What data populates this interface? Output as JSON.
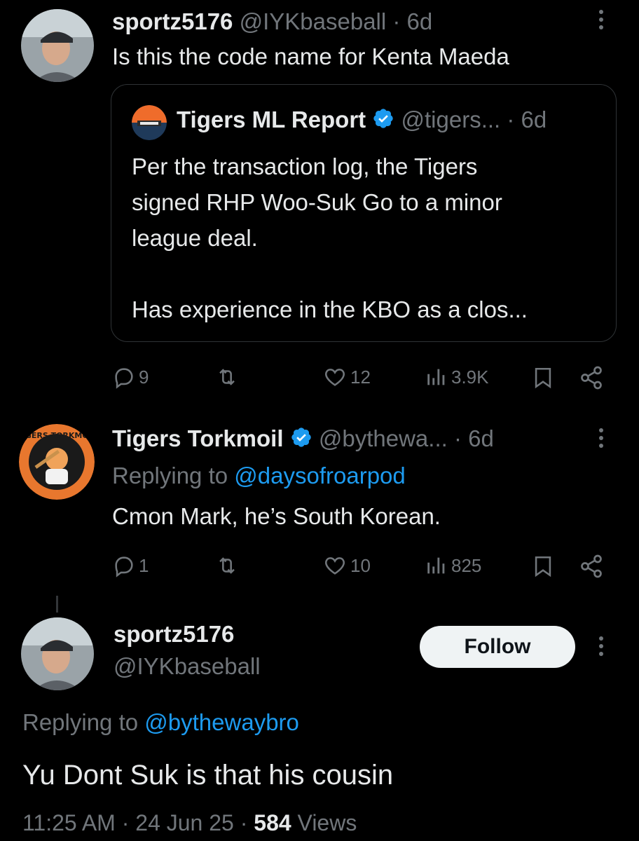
{
  "tweet1": {
    "display_name": "sportz5176",
    "handle": "@IYKbaseball",
    "age": "· 6d",
    "text": "Is this the code name for Kenta Maeda",
    "quote": {
      "display_name": "Tigers ML Report",
      "handle": "@tigers...",
      "age": "· 6d",
      "text_line1": "Per the transaction log, the Tigers",
      "text_line2": "signed RHP Woo-Suk Go to a minor",
      "text_line3": "league deal.",
      "text_line4": "Has experience in the KBO as a clos..."
    },
    "actions": {
      "replies": "9",
      "likes": "12",
      "views": "3.9K"
    }
  },
  "tweet2": {
    "display_name": "Tigers Torkmoil",
    "handle": "@bythewa...",
    "age": "· 6d",
    "replying_prefix": "Replying to",
    "replying_to": "@daysofroarpod",
    "text": "Cmon Mark, he’s South Korean.",
    "avatar_text": "TIGERS TORKMOIL",
    "actions": {
      "replies": "1",
      "likes": "10",
      "views": "825"
    }
  },
  "tweet3": {
    "display_name": "sportz5176",
    "handle": "@IYKbaseball",
    "follow_label": "Follow",
    "replying_prefix": "Replying to",
    "replying_to": "@bythewaybro",
    "text": "Yu Dont Suk is that his cousin",
    "time": "11:25 AM",
    "date": "24 Jun 25",
    "views_count": "584",
    "views_label": "Views"
  },
  "colors": {
    "background": "#000000",
    "text": "#e7e9ea",
    "muted": "#71767b",
    "link": "#1d9bf0",
    "verified": "#1d9bf0",
    "border": "#2f3336"
  },
  "icons": [
    "reply-icon",
    "retweet-icon",
    "like-icon",
    "views-icon",
    "bookmark-icon",
    "share-icon",
    "more-icon",
    "verified-icon"
  ]
}
